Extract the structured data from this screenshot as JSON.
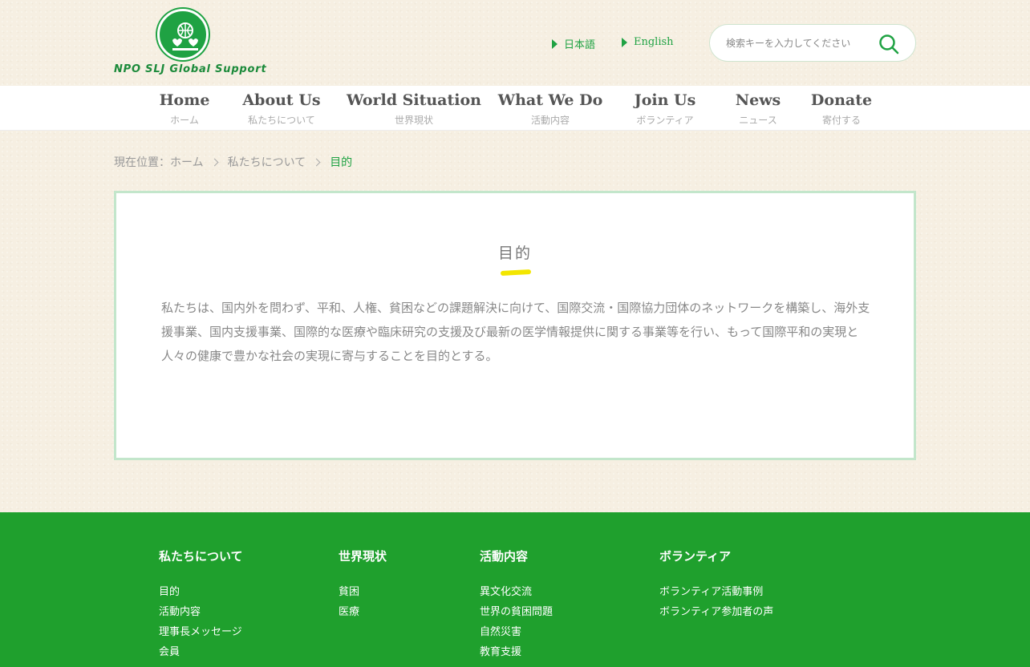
{
  "logo": {
    "text": "NPO SLJ Global Support"
  },
  "lang": {
    "ja": "日本語",
    "en": "English"
  },
  "search": {
    "placeholder": "検索キーを入力してください"
  },
  "nav": [
    {
      "en": "Home",
      "ja": "ホーム"
    },
    {
      "en": "About Us",
      "ja": "私たちについて"
    },
    {
      "en": "World Situation",
      "ja": "世界現状"
    },
    {
      "en": "What We Do",
      "ja": "活動内容"
    },
    {
      "en": "Join Us",
      "ja": "ボランティア"
    },
    {
      "en": "News",
      "ja": "ニュース"
    },
    {
      "en": "Donate",
      "ja": "寄付する"
    }
  ],
  "breadcrumb": {
    "prefix": "現在位置：",
    "home": "ホーム",
    "parent": "私たちについて",
    "current": "目的"
  },
  "main": {
    "title": "目的",
    "body": "私たちは、国内外を問わず、平和、人権、貧困などの課題解決に向けて、国際交流・国際協力団体のネットワークを構築し、海外支援事業、国内支援事業、国際的な医療や臨床研究の支援及び最新の医学情報提供に関する事業等を行い、もって国際平和の実現と人々の健康で豊かな社会の実現に寄与することを目的とする。"
  },
  "footer": {
    "columns": [
      {
        "heading": "私たちについて",
        "links": [
          "目的",
          "活動内容",
          "理事長メッセージ",
          "会員"
        ]
      },
      {
        "heading": "世界現状",
        "links": [
          "貧困",
          "医療"
        ]
      },
      {
        "heading": "活動内容",
        "links": [
          "異文化交流",
          "世界の貧困問題",
          "自然災害",
          "教育支援"
        ]
      },
      {
        "heading": "ボランティア",
        "links": [
          "ボランティア活動事例",
          "ボランティア参加者の声"
        ]
      }
    ]
  },
  "colors": {
    "brand_green": "#1fa243",
    "footer_green": "#1fa02d",
    "accent_yellow": "#f3e600",
    "card_border": "#c3e6cb"
  }
}
